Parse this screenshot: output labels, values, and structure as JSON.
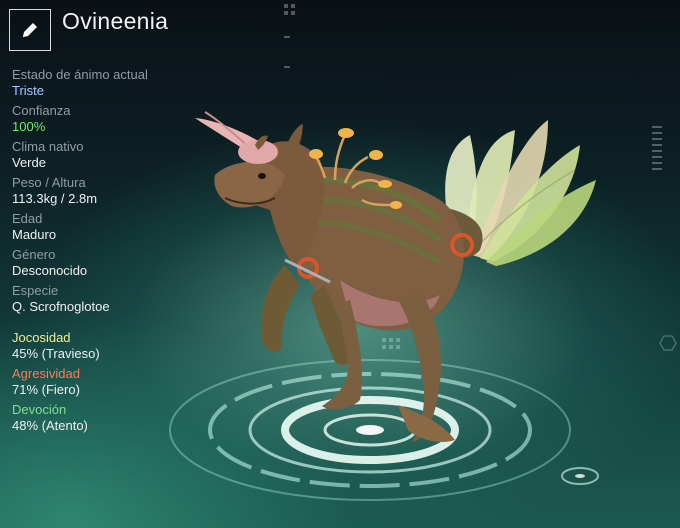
{
  "header": {
    "title": "Ovineenia",
    "edit_icon": "pencil-icon"
  },
  "stats": [
    {
      "label": "Estado de ánimo actual",
      "value": "Triste"
    },
    {
      "label": "Confianza",
      "value": "100%"
    },
    {
      "label": "Clima nativo",
      "value": "Verde"
    },
    {
      "label": "Peso / Altura",
      "value": "113.3kg / 2.8m"
    },
    {
      "label": "Edad",
      "value": "Maduro"
    },
    {
      "label": "Género",
      "value": "Desconocido"
    },
    {
      "label": "Especie",
      "value": "Q. Scrofnoglotoe"
    }
  ],
  "traits": [
    {
      "label": "Jocosidad",
      "value": "45% (Travieso)"
    },
    {
      "label": "Agresividad",
      "value": "71% (Fiero)"
    },
    {
      "label": "Devoción",
      "value": "48% (Atento)"
    }
  ],
  "colors": {
    "mood": "#a9c9ff",
    "trust": "#76e86a",
    "playfulness": "#f1ee8e",
    "aggression": "#ff7a55",
    "devotion": "#7fe08c"
  }
}
